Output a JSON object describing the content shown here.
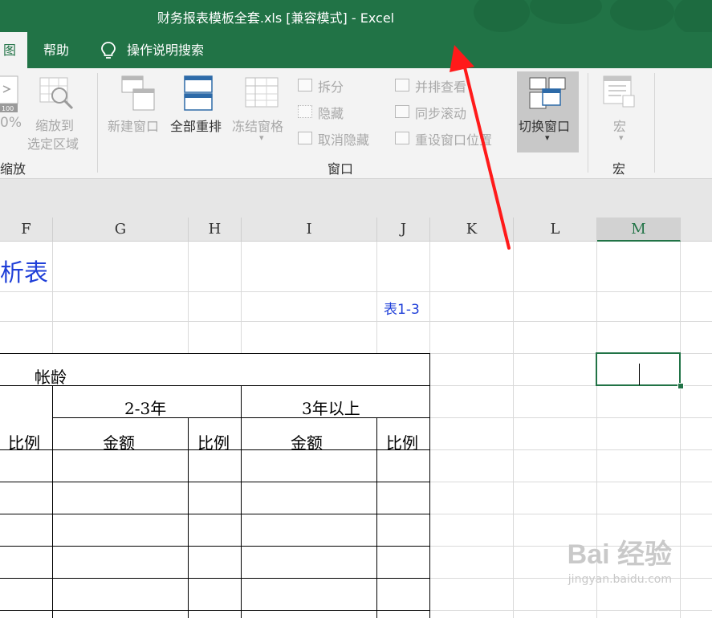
{
  "window": {
    "title": "财务报表模板全套.xls  [兼容模式]  -  Excel"
  },
  "tabs": {
    "partial": "图",
    "help": "帮助",
    "search": "操作说明搜索"
  },
  "ribbon": {
    "zoom": {
      "pct": "0%",
      "zoom_to_selection_1": "缩放到",
      "zoom_to_selection_2": "选定区域",
      "group": "缩放"
    },
    "window": {
      "new_window": "新建窗口",
      "arrange_all": "全部重排",
      "freeze_panes": "冻结窗格",
      "split": "拆分",
      "hide": "隐藏",
      "unhide": "取消隐藏",
      "side_by_side": "并排查看",
      "sync_scroll": "同步滚动",
      "reset_position": "重设窗口位置",
      "switch_windows": "切换窗口",
      "group": "窗口"
    },
    "macros": {
      "label": "宏",
      "group": "宏"
    }
  },
  "grid": {
    "columns": [
      "F",
      "G",
      "H",
      "I",
      "J",
      "K",
      "L",
      "M"
    ],
    "selected_column": "M",
    "title_fragment": "析表",
    "table_ref": "表1-3",
    "aging_header": "帐龄",
    "range_2_3": "2-3年",
    "range_3_plus": "3年以上",
    "col_ratio": "比例",
    "col_amount": "金额"
  },
  "watermark": {
    "brand": "Bai 经验",
    "url": "jingyan.baidu.com"
  },
  "colors": {
    "excel_green": "#217346",
    "arrow_red": "#ff1a1a",
    "blue_text": "#1f3fd8"
  }
}
